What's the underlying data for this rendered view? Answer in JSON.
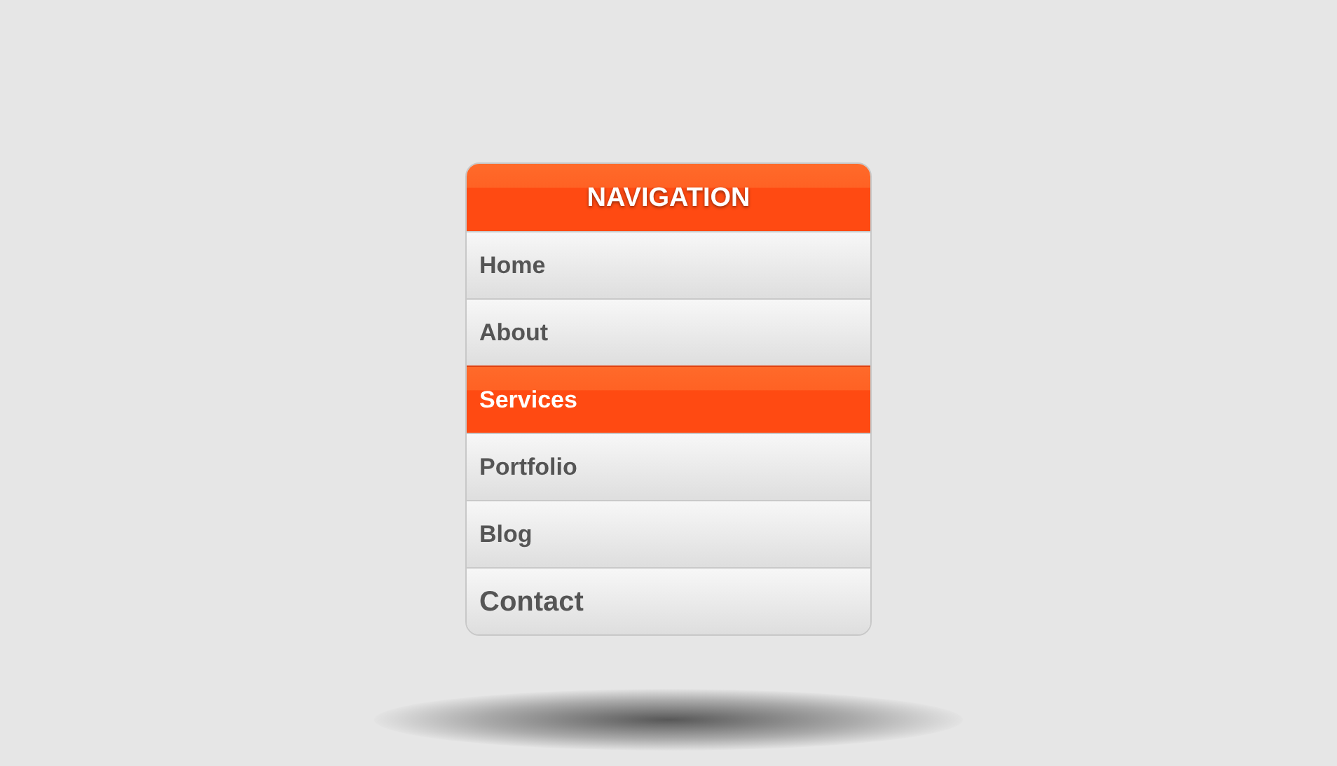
{
  "menu": {
    "title": "NAVIGATION",
    "items": [
      {
        "label": "Home",
        "selected": false
      },
      {
        "label": "About",
        "selected": false
      },
      {
        "label": "Services",
        "selected": true
      },
      {
        "label": "Portfolio",
        "selected": false
      },
      {
        "label": "Blog",
        "selected": false
      },
      {
        "label": "Contact",
        "selected": false
      }
    ]
  }
}
